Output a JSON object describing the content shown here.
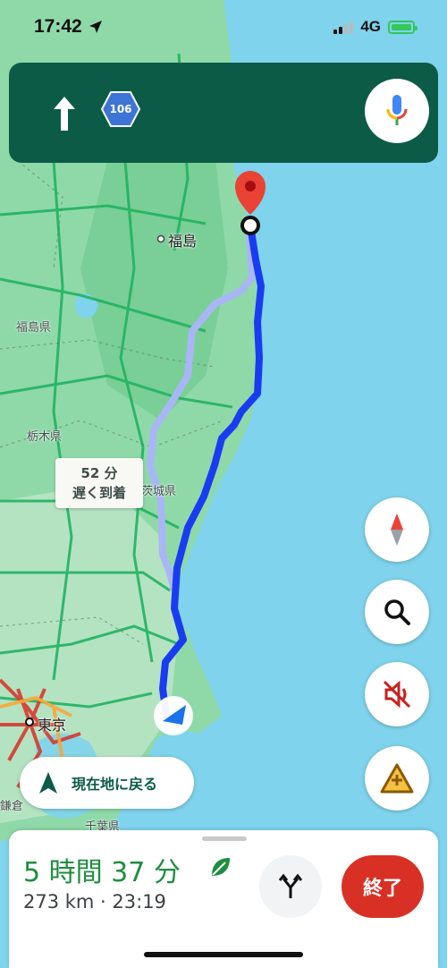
{
  "status_bar": {
    "time": "17:42",
    "network": "4G"
  },
  "nav": {
    "route_shield": "106"
  },
  "map": {
    "labels": {
      "fukushima_city": "福島",
      "fukushima_pref": "福島県",
      "tochigi_pref": "栃木県",
      "ibaraki_pref": "茨城県",
      "tokyo": "東京",
      "chiba": "千葉県",
      "kamakura": "鎌倉"
    },
    "delay_callout": {
      "line1": "52 分",
      "line2": "遅く到着"
    }
  },
  "buttons": {
    "recenter_label": "現在地に戻る",
    "end_label": "終了"
  },
  "trip": {
    "duration": "5 時間 37 分",
    "details": "273 km · 23:19"
  },
  "colors": {
    "nav_green": "#0b5b47",
    "route_blue": "#1a3cf0",
    "end_red": "#d93025",
    "eta_green": "#1e8e3e"
  }
}
